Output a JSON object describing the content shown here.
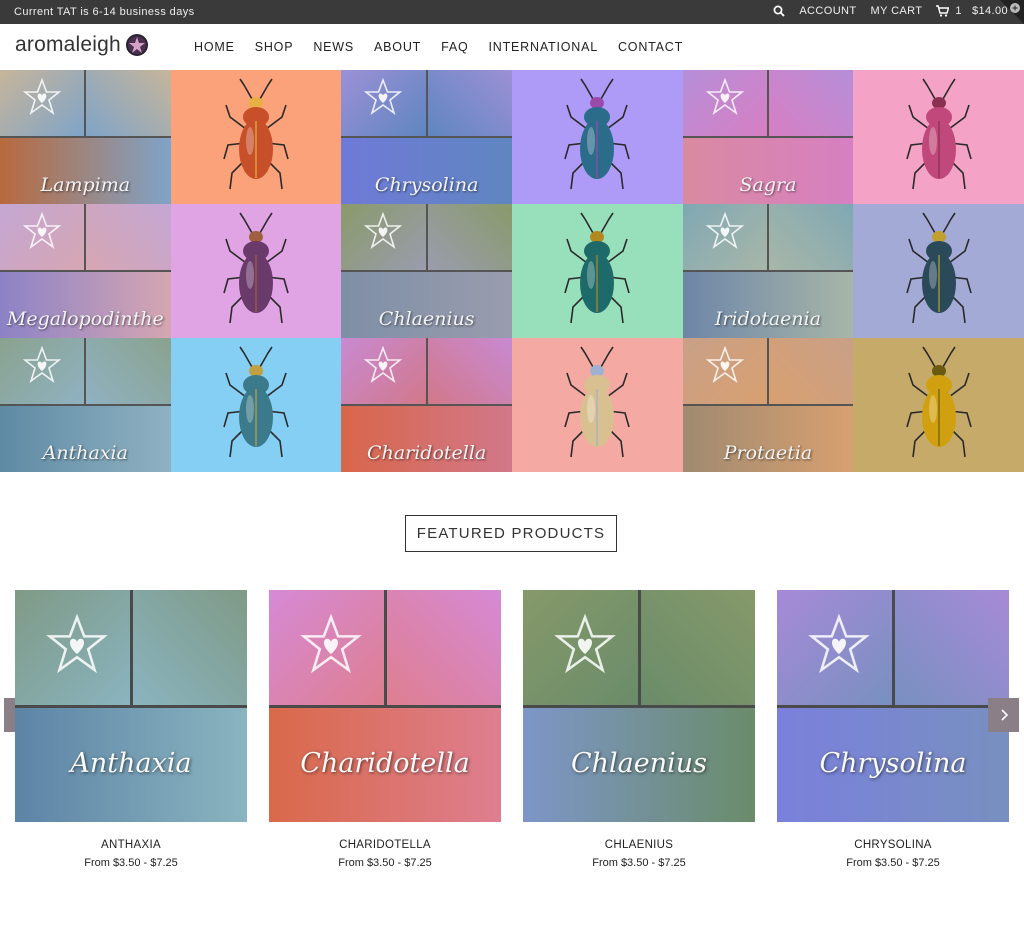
{
  "topbar": {
    "tat_text": "Current TAT is 6-14 business days",
    "account_label": "ACCOUNT",
    "cart_label": "MY CART",
    "cart_count": "1",
    "cart_total": "$14.00",
    "icons": {
      "search": "search-icon",
      "cart": "cart-icon"
    }
  },
  "header": {
    "logo_text": "aromaleigh",
    "nav": [
      {
        "label": "HOME"
      },
      {
        "label": "SHOP"
      },
      {
        "label": "NEWS"
      },
      {
        "label": "ABOUT"
      },
      {
        "label": "FAQ"
      },
      {
        "label": "INTERNATIONAL"
      },
      {
        "label": "CONTACT"
      }
    ]
  },
  "hero": {
    "swatches": [
      {
        "name": "Lampima",
        "colors": [
          "#c7b59a",
          "#7fa4c8",
          "#b8693e"
        ]
      },
      {
        "name": "Chrysolina",
        "colors": [
          "#9c90d6",
          "#5f86c0",
          "#6f7ad8"
        ]
      },
      {
        "name": "Sagra",
        "colors": [
          "#b58ed8",
          "#d77fc3",
          "#d98aa0"
        ]
      },
      {
        "name": "Megalopodinthe",
        "colors": [
          "#c4a7d4",
          "#d6a6b2",
          "#8c82c6"
        ]
      },
      {
        "name": "Chlaenius",
        "colors": [
          "#8a9a6a",
          "#9a9cae",
          "#7e8fa6"
        ]
      },
      {
        "name": "Iridotaenia",
        "colors": [
          "#7fa8b4",
          "#a8b6a8",
          "#6d86a8"
        ]
      },
      {
        "name": "Anthaxia",
        "colors": [
          "#8aa28e",
          "#8fb2c2",
          "#5f8aa4"
        ]
      },
      {
        "name": "Charidotella",
        "colors": [
          "#c88ad2",
          "#d2788a",
          "#d8664a"
        ]
      },
      {
        "name": "Protaetia",
        "colors": [
          "#c8a088",
          "#d8a070",
          "#a08a70"
        ]
      }
    ],
    "beetles": [
      {
        "bg": "#fba27a",
        "body": "#c7502a",
        "accent": "#e8b040"
      },
      {
        "bg": "#ae9af7",
        "body": "#2b6c8a",
        "accent": "#9a4aa8"
      },
      {
        "bg": "#f4a2c6",
        "body": "#c0487a",
        "accent": "#8a3050"
      },
      {
        "bg": "#e0a3e4",
        "body": "#6a3a6a",
        "accent": "#a06040"
      },
      {
        "bg": "#98e0bc",
        "body": "#1e6a6a",
        "accent": "#b08a20"
      },
      {
        "bg": "#a4aad6",
        "body": "#2a4a5a",
        "accent": "#c0a030"
      },
      {
        "bg": "#86cff4",
        "body": "#3a7a8a",
        "accent": "#c0a040"
      },
      {
        "bg": "#f4aaa2",
        "body": "#d8c090",
        "accent": "#a0b0d0"
      },
      {
        "bg": "#c5aa6a",
        "body": "#d0a010",
        "accent": "#6a5a10"
      }
    ]
  },
  "featured": {
    "title": "FEATURED PRODUCTS",
    "products": [
      {
        "name": "ANTHAXIA",
        "script_name": "Anthaxia",
        "price": "From $3.50 - $7.25",
        "colors": [
          "#7f9a86",
          "#8ab4c0",
          "#5d84a6"
        ]
      },
      {
        "name": "CHARIDOTELLA",
        "script_name": "Charidotella",
        "price": "From $3.50 - $7.25",
        "colors": [
          "#d68ad6",
          "#de7e90",
          "#d9694a"
        ]
      },
      {
        "name": "CHLAENIUS",
        "script_name": "Chlaenius",
        "price": "From $3.50 - $7.25",
        "colors": [
          "#86996a",
          "#6a8c6a",
          "#7d96c8"
        ]
      },
      {
        "name": "CHRYSOLINA",
        "script_name": "Chrysolina",
        "price": "From $3.50 - $7.25",
        "colors": [
          "#a78ad8",
          "#7890c0",
          "#7a80dc"
        ]
      }
    ],
    "prev_icon": "chevron-left-icon",
    "next_icon": "chevron-right-icon"
  },
  "colors": {
    "topbar_bg": "#3a3a3a",
    "arrow_bg": "#8a7f87"
  }
}
